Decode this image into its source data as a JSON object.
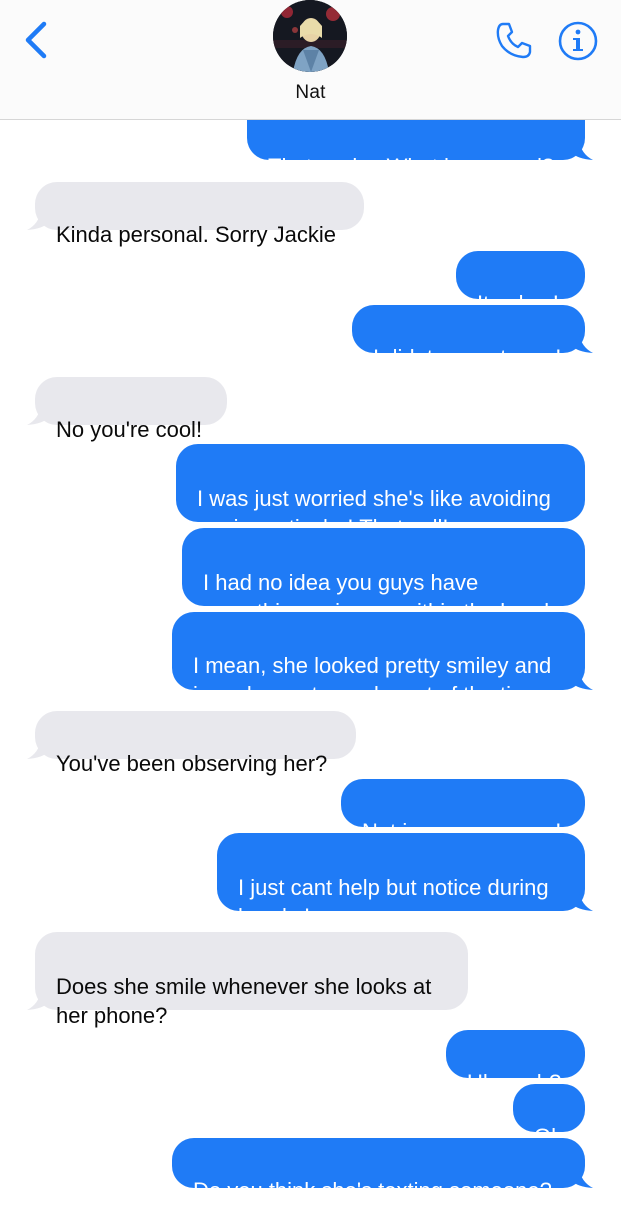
{
  "header": {
    "contact_name": "Nat"
  },
  "colors": {
    "outgoing": "#1f7bf6",
    "incoming": "#e8e8ed",
    "accent": "#1f7bf6"
  },
  "icons": {
    "back": "chevron-left-icon",
    "phone": "phone-icon",
    "info": "info-icon"
  },
  "messages": [
    {
      "direction": "outgoing",
      "text": "That sucks. What happened?"
    },
    {
      "direction": "incoming",
      "text": "Kinda personal. Sorry Jackie"
    },
    {
      "direction": "outgoing",
      "text": "Its okay!"
    },
    {
      "direction": "outgoing",
      "text": "I didnt mean to pry!"
    },
    {
      "direction": "incoming",
      "text": "No you're cool!"
    },
    {
      "direction": "outgoing",
      "text": "I was just worried she's like avoiding\nme in particular! Thats all!"
    },
    {
      "direction": "outgoing",
      "text": "I had no idea you guys have\nsomething going on within the band"
    },
    {
      "direction": "outgoing",
      "text": "I mean, she looked pretty smiley and\nin a pleasant mood most of the time"
    },
    {
      "direction": "incoming",
      "text": "You've been observing her?"
    },
    {
      "direction": "outgoing",
      "text": "Not in a creepy way!"
    },
    {
      "direction": "outgoing",
      "text": "I just cant help but notice during\nbreaks!"
    },
    {
      "direction": "incoming",
      "text": "Does she smile whenever she looks at\nher phone?"
    },
    {
      "direction": "outgoing",
      "text": "Uh yeah?"
    },
    {
      "direction": "outgoing",
      "text": "Oh"
    },
    {
      "direction": "outgoing",
      "text": "Do you think she's texting someone?"
    }
  ]
}
